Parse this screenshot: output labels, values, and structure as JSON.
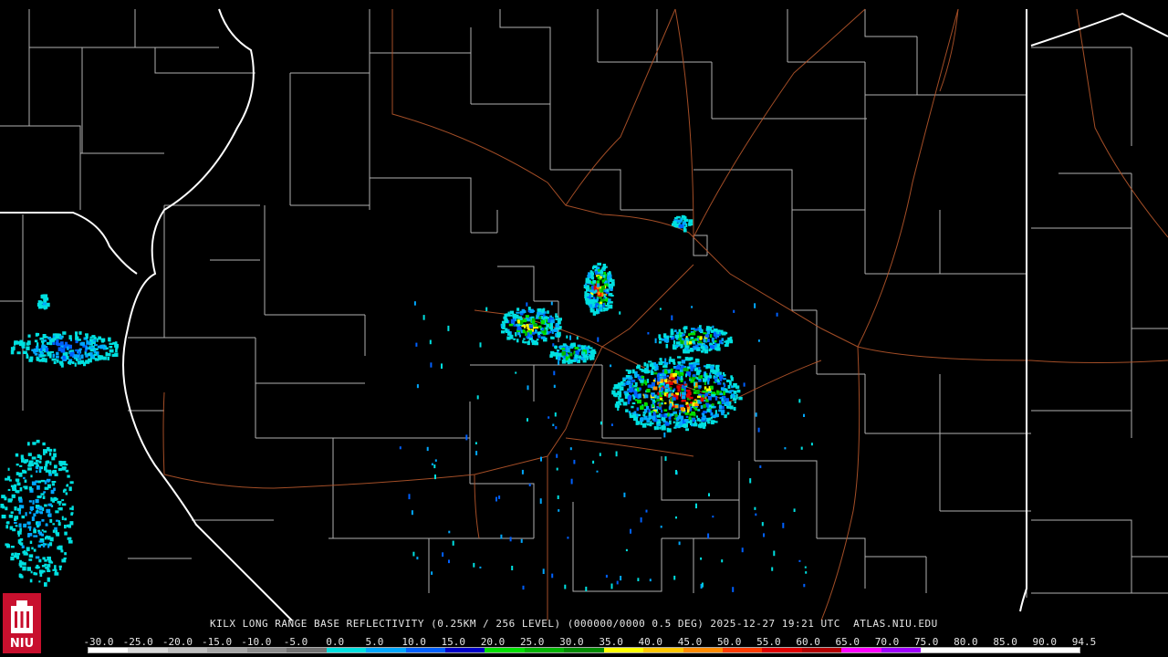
{
  "map": {
    "title": "KILX LONG RANGE BASE REFLECTIVITY (0.25KM / 256 LEVEL) (000000/0000 0.5 DEG) 2025-12-27 19:21 UTC  ATLAS.NIU.EDU",
    "background_color": "#000000",
    "county_line_color": "#d8d8d8",
    "state_line_color": "#ffffff",
    "highway_color": "#b5562b",
    "radar_site": "KILX"
  },
  "legend": {
    "labels": [
      "-30.0",
      "-25.0",
      "-20.0",
      "-15.0",
      "-10.0",
      "-5.0",
      "0.0",
      "5.0",
      "10.0",
      "15.0",
      "20.0",
      "25.0",
      "30.0",
      "35.0",
      "40.0",
      "45.0",
      "50.0",
      "55.0",
      "60.0",
      "65.0",
      "70.0",
      "75.0",
      "80.0",
      "85.0",
      "90.0",
      "94.5"
    ],
    "colors": [
      "#ffffff",
      "#d9d9d9",
      "#bfbfbf",
      "#a6a6a6",
      "#8c8c8c",
      "#737373",
      "#00e0e0",
      "#00a8ff",
      "#0060ff",
      "#0000c8",
      "#00e000",
      "#00b400",
      "#008c00",
      "#ffff00",
      "#ffc800",
      "#ff8c00",
      "#ff3c00",
      "#e00000",
      "#b40000",
      "#ff00ff",
      "#a000ff",
      "#ffffff",
      "#ffffff",
      "#ffffff",
      "#ffffff"
    ]
  },
  "logo": {
    "text": "NIU",
    "icon": "niu-tower-icon"
  }
}
